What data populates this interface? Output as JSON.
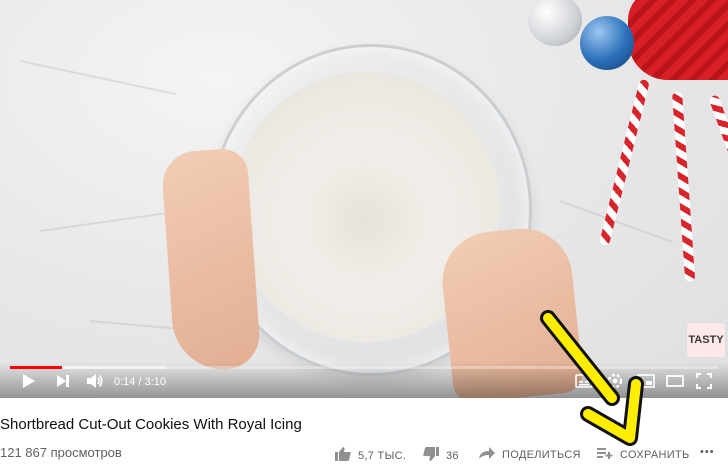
{
  "player": {
    "time_display": "0:14 / 3:10",
    "progress_fraction": 0.074,
    "buffer_fraction": 0.22,
    "channel_badge": "TASTY",
    "accent_color": "#ff0000"
  },
  "video": {
    "title": "Shortbread Cut-Out Cookies With Royal Icing",
    "views": "121 867 просмотров"
  },
  "actions": {
    "like_count": "5,7 ТЫС.",
    "dislike_count": "36",
    "share_label": "ПОДЕЛИТЬСЯ",
    "save_label": "СОХРАНИТЬ",
    "more_label": "•••"
  },
  "icons": {
    "play": "play-icon",
    "next": "next-icon",
    "volume": "volume-icon",
    "subtitles": "subtitles-icon",
    "settings": "settings-icon",
    "miniplayer": "miniplayer-icon",
    "theater": "theater-icon",
    "fullscreen": "fullscreen-icon",
    "like": "thumbs-up-icon",
    "dislike": "thumbs-down-icon",
    "share": "share-icon",
    "save": "playlist-add-icon"
  }
}
